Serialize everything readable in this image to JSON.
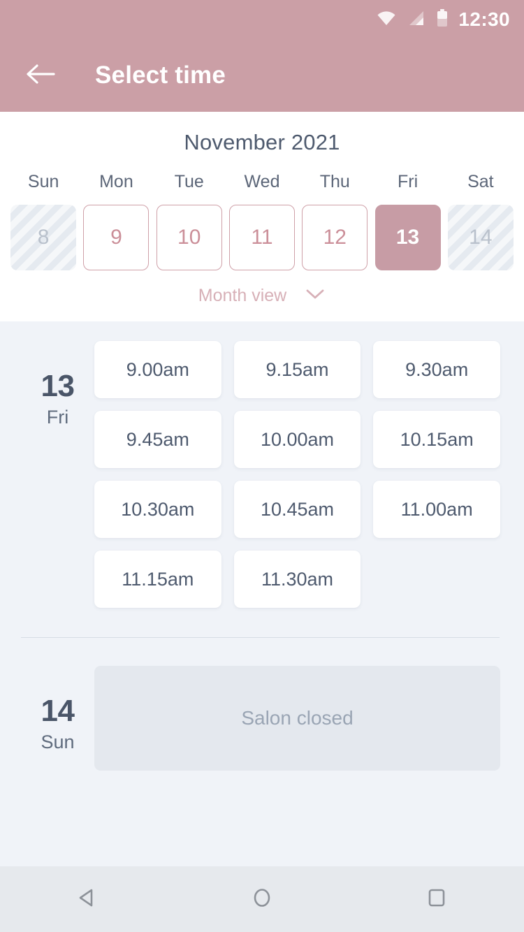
{
  "status_bar": {
    "time": "12:30",
    "icons": [
      "wifi-icon",
      "signal-icon",
      "battery-icon"
    ]
  },
  "app_bar": {
    "back_icon": "arrow-left-icon",
    "title": "Select time"
  },
  "calendar": {
    "month_title": "November 2021",
    "weekdays": [
      "Sun",
      "Mon",
      "Tue",
      "Wed",
      "Thu",
      "Fri",
      "Sat"
    ],
    "dates": [
      {
        "day": "8",
        "state": "disabled"
      },
      {
        "day": "9",
        "state": "available"
      },
      {
        "day": "10",
        "state": "available"
      },
      {
        "day": "11",
        "state": "available"
      },
      {
        "day": "12",
        "state": "available"
      },
      {
        "day": "13",
        "state": "selected"
      },
      {
        "day": "14",
        "state": "disabled"
      }
    ],
    "month_view_label": "Month view",
    "month_view_icon": "chevron-down-icon"
  },
  "schedule": [
    {
      "day_number": "13",
      "day_of_week": "Fri",
      "slots": [
        "9.00am",
        "9.15am",
        "9.30am",
        "9.45am",
        "10.00am",
        "10.15am",
        "10.30am",
        "10.45am",
        "11.00am",
        "11.15am",
        "11.30am"
      ]
    },
    {
      "day_number": "14",
      "day_of_week": "Sun",
      "closed_label": "Salon closed"
    }
  ],
  "nav_bar": {
    "back_icon": "triangle-back-icon",
    "home_icon": "circle-home-icon",
    "recents_icon": "square-recents-icon"
  },
  "colors": {
    "brand_rose": "#cb9fa6",
    "selected_date": "#c79ca5",
    "date_border": "#cfa0a8",
    "body_background": "#f0f3f8",
    "card_white": "#ffffff",
    "text_slate": "#4e5a6e",
    "closed_card": "#e4e8ee",
    "nav_bar": "#e6e9ed"
  }
}
